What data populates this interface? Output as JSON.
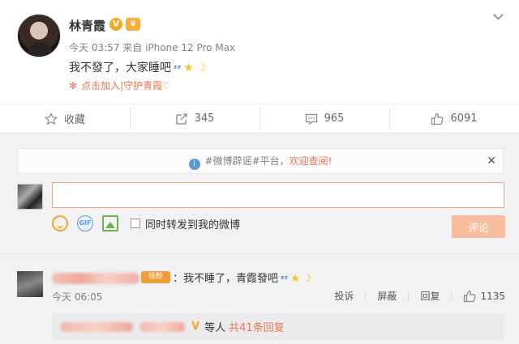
{
  "post": {
    "username": "林青霞",
    "verified_badge": "V",
    "time": "今天 03:57",
    "source_prefix": "来自",
    "device": "iPhone 12 Pro Max",
    "text": "我不發了，大家睡吧",
    "emoji": {
      "sleep": "ᶻᶻ",
      "star": "★",
      "moon": "☽"
    },
    "support_link": "点击加入|守护青霞♡",
    "support_icon": "✻"
  },
  "actions": {
    "favorite": "收藏",
    "repost": "345",
    "comment": "965",
    "like": "6091"
  },
  "comment_box": {
    "notice_pre": "#微博辟谣#平台，",
    "notice_link": "欢迎查阅!",
    "input_value": "",
    "forward_label": "同时转发到我的微博",
    "submit": "评论",
    "gif_label": "GIF"
  },
  "comment": {
    "fan_badge": "铁粉",
    "text": "：我不睡了，青霞發吧",
    "time": "今天 06:05",
    "report": "投诉",
    "block": "屏蔽",
    "reply": "回复",
    "likes": "1135"
  },
  "replies": {
    "v_badge": "V",
    "suffix": "等人",
    "count_text": "共41条回复"
  },
  "colors": {
    "accent": "#eb7350",
    "submit_bg": "#f8bc9f",
    "vip": "#f6a623"
  }
}
